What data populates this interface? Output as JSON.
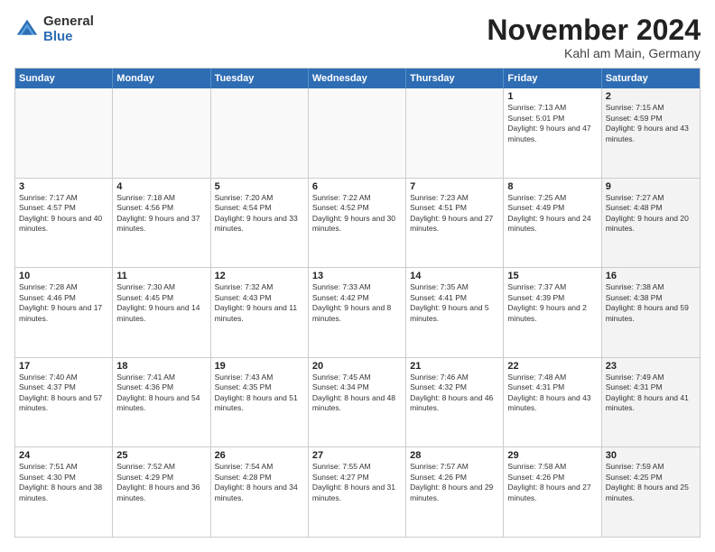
{
  "logo": {
    "general": "General",
    "blue": "Blue"
  },
  "title": "November 2024",
  "location": "Kahl am Main, Germany",
  "header": {
    "days": [
      "Sunday",
      "Monday",
      "Tuesday",
      "Wednesday",
      "Thursday",
      "Friday",
      "Saturday"
    ]
  },
  "rows": [
    [
      {
        "day": "",
        "text": "",
        "empty": true
      },
      {
        "day": "",
        "text": "",
        "empty": true
      },
      {
        "day": "",
        "text": "",
        "empty": true
      },
      {
        "day": "",
        "text": "",
        "empty": true
      },
      {
        "day": "",
        "text": "",
        "empty": true
      },
      {
        "day": "1",
        "text": "Sunrise: 7:13 AM\nSunset: 5:01 PM\nDaylight: 9 hours and 47 minutes.",
        "empty": false,
        "shaded": false
      },
      {
        "day": "2",
        "text": "Sunrise: 7:15 AM\nSunset: 4:59 PM\nDaylight: 9 hours and 43 minutes.",
        "empty": false,
        "shaded": true
      }
    ],
    [
      {
        "day": "3",
        "text": "Sunrise: 7:17 AM\nSunset: 4:57 PM\nDaylight: 9 hours and 40 minutes.",
        "empty": false,
        "shaded": false
      },
      {
        "day": "4",
        "text": "Sunrise: 7:18 AM\nSunset: 4:56 PM\nDaylight: 9 hours and 37 minutes.",
        "empty": false,
        "shaded": false
      },
      {
        "day": "5",
        "text": "Sunrise: 7:20 AM\nSunset: 4:54 PM\nDaylight: 9 hours and 33 minutes.",
        "empty": false,
        "shaded": false
      },
      {
        "day": "6",
        "text": "Sunrise: 7:22 AM\nSunset: 4:52 PM\nDaylight: 9 hours and 30 minutes.",
        "empty": false,
        "shaded": false
      },
      {
        "day": "7",
        "text": "Sunrise: 7:23 AM\nSunset: 4:51 PM\nDaylight: 9 hours and 27 minutes.",
        "empty": false,
        "shaded": false
      },
      {
        "day": "8",
        "text": "Sunrise: 7:25 AM\nSunset: 4:49 PM\nDaylight: 9 hours and 24 minutes.",
        "empty": false,
        "shaded": false
      },
      {
        "day": "9",
        "text": "Sunrise: 7:27 AM\nSunset: 4:48 PM\nDaylight: 9 hours and 20 minutes.",
        "empty": false,
        "shaded": true
      }
    ],
    [
      {
        "day": "10",
        "text": "Sunrise: 7:28 AM\nSunset: 4:46 PM\nDaylight: 9 hours and 17 minutes.",
        "empty": false,
        "shaded": false
      },
      {
        "day": "11",
        "text": "Sunrise: 7:30 AM\nSunset: 4:45 PM\nDaylight: 9 hours and 14 minutes.",
        "empty": false,
        "shaded": false
      },
      {
        "day": "12",
        "text": "Sunrise: 7:32 AM\nSunset: 4:43 PM\nDaylight: 9 hours and 11 minutes.",
        "empty": false,
        "shaded": false
      },
      {
        "day": "13",
        "text": "Sunrise: 7:33 AM\nSunset: 4:42 PM\nDaylight: 9 hours and 8 minutes.",
        "empty": false,
        "shaded": false
      },
      {
        "day": "14",
        "text": "Sunrise: 7:35 AM\nSunset: 4:41 PM\nDaylight: 9 hours and 5 minutes.",
        "empty": false,
        "shaded": false
      },
      {
        "day": "15",
        "text": "Sunrise: 7:37 AM\nSunset: 4:39 PM\nDaylight: 9 hours and 2 minutes.",
        "empty": false,
        "shaded": false
      },
      {
        "day": "16",
        "text": "Sunrise: 7:38 AM\nSunset: 4:38 PM\nDaylight: 8 hours and 59 minutes.",
        "empty": false,
        "shaded": true
      }
    ],
    [
      {
        "day": "17",
        "text": "Sunrise: 7:40 AM\nSunset: 4:37 PM\nDaylight: 8 hours and 57 minutes.",
        "empty": false,
        "shaded": false
      },
      {
        "day": "18",
        "text": "Sunrise: 7:41 AM\nSunset: 4:36 PM\nDaylight: 8 hours and 54 minutes.",
        "empty": false,
        "shaded": false
      },
      {
        "day": "19",
        "text": "Sunrise: 7:43 AM\nSunset: 4:35 PM\nDaylight: 8 hours and 51 minutes.",
        "empty": false,
        "shaded": false
      },
      {
        "day": "20",
        "text": "Sunrise: 7:45 AM\nSunset: 4:34 PM\nDaylight: 8 hours and 48 minutes.",
        "empty": false,
        "shaded": false
      },
      {
        "day": "21",
        "text": "Sunrise: 7:46 AM\nSunset: 4:32 PM\nDaylight: 8 hours and 46 minutes.",
        "empty": false,
        "shaded": false
      },
      {
        "day": "22",
        "text": "Sunrise: 7:48 AM\nSunset: 4:31 PM\nDaylight: 8 hours and 43 minutes.",
        "empty": false,
        "shaded": false
      },
      {
        "day": "23",
        "text": "Sunrise: 7:49 AM\nSunset: 4:31 PM\nDaylight: 8 hours and 41 minutes.",
        "empty": false,
        "shaded": true
      }
    ],
    [
      {
        "day": "24",
        "text": "Sunrise: 7:51 AM\nSunset: 4:30 PM\nDaylight: 8 hours and 38 minutes.",
        "empty": false,
        "shaded": false
      },
      {
        "day": "25",
        "text": "Sunrise: 7:52 AM\nSunset: 4:29 PM\nDaylight: 8 hours and 36 minutes.",
        "empty": false,
        "shaded": false
      },
      {
        "day": "26",
        "text": "Sunrise: 7:54 AM\nSunset: 4:28 PM\nDaylight: 8 hours and 34 minutes.",
        "empty": false,
        "shaded": false
      },
      {
        "day": "27",
        "text": "Sunrise: 7:55 AM\nSunset: 4:27 PM\nDaylight: 8 hours and 31 minutes.",
        "empty": false,
        "shaded": false
      },
      {
        "day": "28",
        "text": "Sunrise: 7:57 AM\nSunset: 4:26 PM\nDaylight: 8 hours and 29 minutes.",
        "empty": false,
        "shaded": false
      },
      {
        "day": "29",
        "text": "Sunrise: 7:58 AM\nSunset: 4:26 PM\nDaylight: 8 hours and 27 minutes.",
        "empty": false,
        "shaded": false
      },
      {
        "day": "30",
        "text": "Sunrise: 7:59 AM\nSunset: 4:25 PM\nDaylight: 8 hours and 25 minutes.",
        "empty": false,
        "shaded": true
      }
    ]
  ]
}
